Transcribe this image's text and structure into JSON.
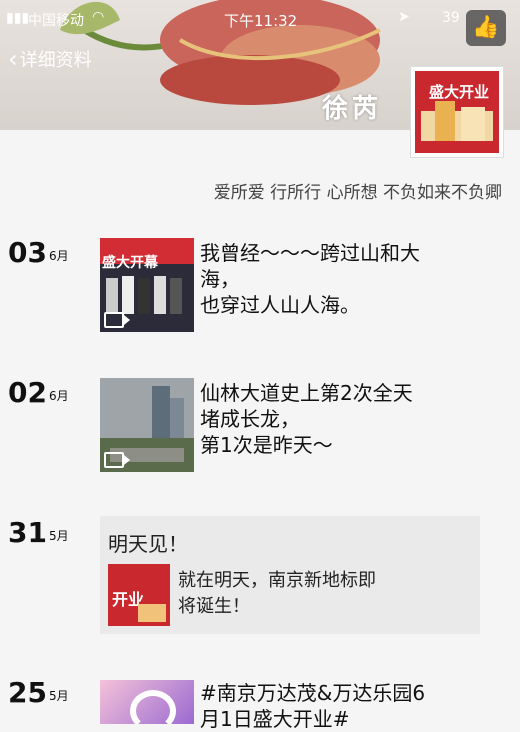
{
  "status": {
    "carrier": "中国移动",
    "time": "下午11:32",
    "battery": "39"
  },
  "nav": {
    "back_label": "详细资料"
  },
  "profile": {
    "nickname": "徐芮",
    "avatar_text": "盛大开业",
    "signature": "爱所爱 行所行 心所想 不负如来不负卿"
  },
  "posts": [
    {
      "day": "03",
      "month": "6月",
      "thumb_text": "盛大开幕",
      "text_lines": [
        "我曾经～～～跨过山和大",
        "海，",
        "也穿过人山人海。"
      ]
    },
    {
      "day": "02",
      "month": "6月",
      "text_lines": [
        "仙林大道史上第2次全天",
        "堵成长龙，",
        "第1次是昨天～"
      ]
    },
    {
      "day": "31",
      "month": "5月",
      "card_title": "明天见！",
      "card_sub_text": "开业",
      "card_text_lines": [
        "就在明天，南京新地标即",
        "将诞生！"
      ]
    },
    {
      "day": "25",
      "month": "5月",
      "text_lines": [
        "#南京万达茂&万达乐园6",
        "月1日盛大开业#"
      ]
    }
  ]
}
